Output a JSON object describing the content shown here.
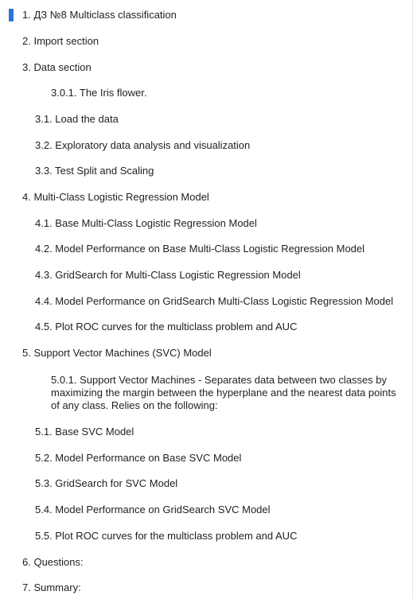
{
  "outline": {
    "items": [
      {
        "label": "1. ДЗ №8 Multiclass classification",
        "level": 1,
        "active": true
      },
      {
        "label": "2. Import section",
        "level": 1
      },
      {
        "label": "3. Data section",
        "level": 1
      },
      {
        "label": "3.0.1. The Iris flower.",
        "level": 3
      },
      {
        "label": "3.1. Load the data",
        "level": 2
      },
      {
        "label": "3.2. Exploratory data analysis and visualization",
        "level": 2
      },
      {
        "label": "3.3. Test Split and Scaling",
        "level": 2
      },
      {
        "label": "4. Multi-Class Logistic Regression Model",
        "level": 1
      },
      {
        "label": "4.1. Base Multi-Class Logistic Regression Model",
        "level": 2
      },
      {
        "label": "4.2. Model Performance on Base Multi-Class Logistic Regression Model",
        "level": 2
      },
      {
        "label": "4.3. GridSearch for Multi-Class Logistic Regression Model",
        "level": 2
      },
      {
        "label": "4.4. Model Performance on GridSearch Multi-Class Logistic Regression Model",
        "level": 2
      },
      {
        "label": "4.5. Plot ROC curves for the multiclass problem and AUC",
        "level": 2
      },
      {
        "label": "5. Support Vector Machines (SVC) Model",
        "level": 1
      },
      {
        "label": "5.0.1. Support Vector Machines - Separates data between two classes by maximizing the margin between the hyperplane and the nearest data points of any class. Relies on the following:",
        "level": 3
      },
      {
        "label": "5.1. Base SVC Model",
        "level": 2
      },
      {
        "label": "5.2. Model Performance on Base SVC Model",
        "level": 2
      },
      {
        "label": "5.3. GridSearch for SVC Model",
        "level": 2
      },
      {
        "label": "5.4. Model Performance on GridSearch SVC Model",
        "level": 2
      },
      {
        "label": "5.5. Plot ROC curves for the multiclass problem and AUC",
        "level": 2
      },
      {
        "label": "6. Questions:",
        "level": 1
      },
      {
        "label": "7. Summary:",
        "level": 1
      }
    ]
  },
  "colors": {
    "active_marker": "#2b74d9",
    "text": "#1f1f1f"
  }
}
